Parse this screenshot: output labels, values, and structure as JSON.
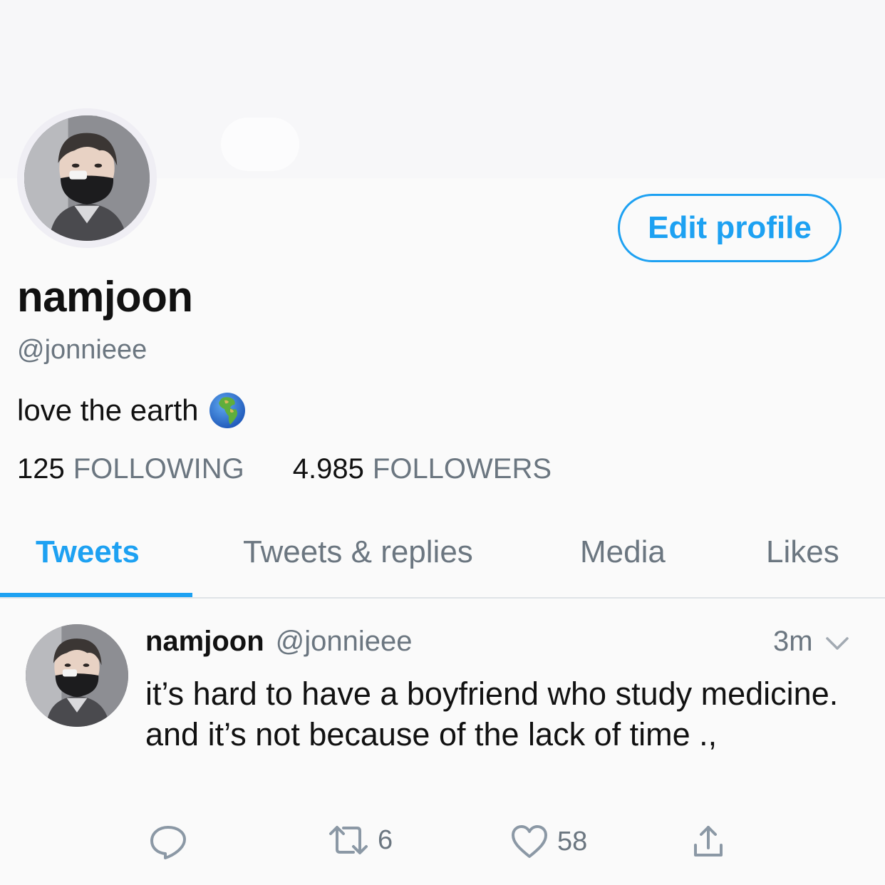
{
  "profile": {
    "display_name": "namjoon",
    "handle": "@jonnieee",
    "bio": "love the earth",
    "bio_emoji": "globe-europe-africa",
    "edit_button_label": "Edit profile"
  },
  "stats": {
    "following_count": "125",
    "following_label": "FOLLOWING",
    "followers_count": "4.985",
    "followers_label": "FOLLOWERS"
  },
  "tabs": [
    {
      "label": "Tweets",
      "active": true
    },
    {
      "label": "Tweets & replies",
      "active": false
    },
    {
      "label": "Media",
      "active": false
    },
    {
      "label": "Likes",
      "active": false
    }
  ],
  "tweet": {
    "name": "namjoon",
    "handle": "@jonnieee",
    "time": "3m",
    "text": "it’s hard to have a boyfriend who study medicine. and it’s not because of the lack of time .,",
    "actions": {
      "reply_icon": "reply-icon",
      "retweet_icon": "retweet-icon",
      "retweet_count": "6",
      "like_icon": "heart-icon",
      "like_count": "58",
      "share_icon": "share-icon"
    }
  },
  "colors": {
    "accent": "#1da1f2",
    "muted_text": "#6b7680",
    "primary_text": "#111111",
    "background": "#fafafa",
    "divider": "#dfe3e7"
  }
}
